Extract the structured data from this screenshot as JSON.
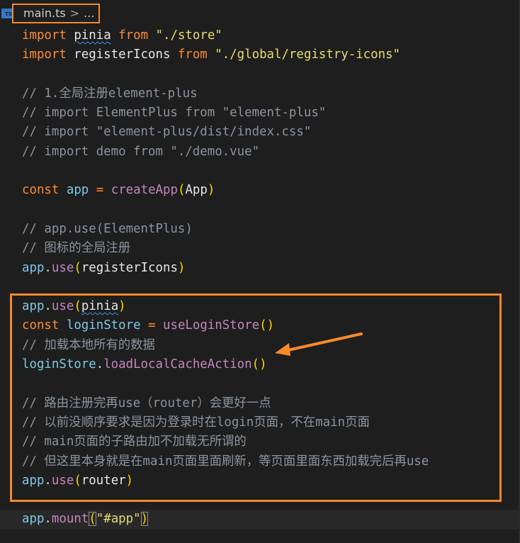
{
  "breadcrumb": {
    "file_icon_label": "TS",
    "file_name": "main.ts",
    "separator": ">",
    "ellipsis": "..."
  },
  "code_lines": [
    {
      "segments": [
        {
          "cls": "kw",
          "text": "import"
        },
        {
          "cls": "id",
          "text": " "
        },
        {
          "cls": "id squiggle",
          "text": "pinia"
        },
        {
          "cls": "id",
          "text": " "
        },
        {
          "cls": "kw",
          "text": "from"
        },
        {
          "cls": "id",
          "text": " "
        },
        {
          "cls": "str",
          "text": "\"./store\""
        }
      ]
    },
    {
      "segments": [
        {
          "cls": "kw",
          "text": "import"
        },
        {
          "cls": "id",
          "text": " registerIcons "
        },
        {
          "cls": "kw",
          "text": "from"
        },
        {
          "cls": "id",
          "text": " "
        },
        {
          "cls": "str",
          "text": "\"./global/registry-icons\""
        }
      ]
    },
    {
      "segments": []
    },
    {
      "segments": [
        {
          "cls": "cm",
          "text": "// 1.全局注册element-plus"
        }
      ]
    },
    {
      "segments": [
        {
          "cls": "cm",
          "text": "// import ElementPlus from \"element-plus\""
        }
      ]
    },
    {
      "segments": [
        {
          "cls": "cm",
          "text": "// import \"element-plus/dist/index.css\""
        }
      ]
    },
    {
      "segments": [
        {
          "cls": "cm",
          "text": "// import demo from \"./demo.vue\""
        }
      ]
    },
    {
      "segments": []
    },
    {
      "segments": [
        {
          "cls": "kw",
          "text": "const"
        },
        {
          "cls": "id",
          "text": " "
        },
        {
          "cls": "var",
          "text": "app"
        },
        {
          "cls": "id",
          "text": " "
        },
        {
          "cls": "op",
          "text": "="
        },
        {
          "cls": "id",
          "text": " "
        },
        {
          "cls": "fn",
          "text": "createApp"
        },
        {
          "cls": "paren1",
          "text": "("
        },
        {
          "cls": "id",
          "text": "App"
        },
        {
          "cls": "paren1",
          "text": ")"
        }
      ]
    },
    {
      "segments": []
    },
    {
      "segments": [
        {
          "cls": "cm",
          "text": "// app.use(ElementPlus)"
        }
      ]
    },
    {
      "segments": [
        {
          "cls": "cm",
          "text": "// 图标的全局注册"
        }
      ]
    },
    {
      "segments": [
        {
          "cls": "var",
          "text": "app"
        },
        {
          "cls": "punc",
          "text": "."
        },
        {
          "cls": "fn",
          "text": "use"
        },
        {
          "cls": "paren1",
          "text": "("
        },
        {
          "cls": "id",
          "text": "registerIcons"
        },
        {
          "cls": "paren1",
          "text": ")"
        }
      ]
    },
    {
      "segments": []
    },
    {
      "segments": [
        {
          "cls": "var",
          "text": "app"
        },
        {
          "cls": "punc",
          "text": "."
        },
        {
          "cls": "fn",
          "text": "use"
        },
        {
          "cls": "paren1",
          "text": "("
        },
        {
          "cls": "id squiggle",
          "text": "pinia"
        },
        {
          "cls": "paren1",
          "text": ")"
        }
      ]
    },
    {
      "segments": [
        {
          "cls": "kw",
          "text": "const"
        },
        {
          "cls": "id",
          "text": " "
        },
        {
          "cls": "var",
          "text": "loginStore"
        },
        {
          "cls": "id",
          "text": " "
        },
        {
          "cls": "op",
          "text": "="
        },
        {
          "cls": "id",
          "text": " "
        },
        {
          "cls": "fn",
          "text": "useLoginStore"
        },
        {
          "cls": "paren1",
          "text": "()"
        }
      ]
    },
    {
      "segments": [
        {
          "cls": "cm",
          "text": "// 加载本地所有的数据"
        }
      ]
    },
    {
      "segments": [
        {
          "cls": "var",
          "text": "loginStore"
        },
        {
          "cls": "punc",
          "text": "."
        },
        {
          "cls": "fn",
          "text": "loadLocalCacheAction"
        },
        {
          "cls": "paren1",
          "text": "()"
        }
      ]
    },
    {
      "segments": []
    },
    {
      "segments": [
        {
          "cls": "cm",
          "text": "// 路由注册完再use（router）会更好一点"
        }
      ]
    },
    {
      "segments": [
        {
          "cls": "cm",
          "text": "// 以前没顺序要求是因为登录时在login页面，不在main页面"
        }
      ]
    },
    {
      "segments": [
        {
          "cls": "cm",
          "text": "// main页面的子路由加不加载无所谓的"
        }
      ]
    },
    {
      "segments": [
        {
          "cls": "cm",
          "text": "// 但这里本身就是在main页面里面刷新，等页面里面东西加载完后再use"
        }
      ]
    },
    {
      "segments": [
        {
          "cls": "var",
          "text": "app"
        },
        {
          "cls": "punc",
          "text": "."
        },
        {
          "cls": "fn",
          "text": "use"
        },
        {
          "cls": "paren1",
          "text": "("
        },
        {
          "cls": "id",
          "text": "router"
        },
        {
          "cls": "paren1",
          "text": ")"
        }
      ]
    },
    {
      "segments": []
    },
    {
      "current": true,
      "segments": [
        {
          "cls": "var",
          "text": "app"
        },
        {
          "cls": "punc",
          "text": "."
        },
        {
          "cls": "fn",
          "text": "mount"
        },
        {
          "cls": "paren1 bracket-box",
          "text": "("
        },
        {
          "cls": "str",
          "text": "\"#app\""
        },
        {
          "cls": "paren1 bracket-box",
          "text": ")"
        }
      ]
    }
  ],
  "colors": {
    "editor_bg": "#1e1e1e",
    "highlight": "#f7892b",
    "keyword": "#ff8c2f",
    "string": "#e6db74",
    "comment": "#8b949e"
  }
}
